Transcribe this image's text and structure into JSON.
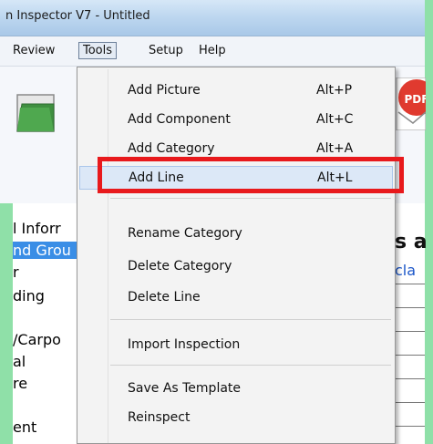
{
  "window": {
    "title": "n Inspector V7 - Untitled"
  },
  "menubar": {
    "items": [
      {
        "label": "Review",
        "active": false
      },
      {
        "label": "Tools",
        "active": true
      },
      {
        "label": "Setup",
        "active": false
      },
      {
        "label": "Help",
        "active": false
      }
    ]
  },
  "toolbar": {
    "pdf_label": "PDF"
  },
  "left_panel": {
    "items": [
      "l Inforr",
      "nd Grou",
      "r",
      "ding",
      "/Carpo",
      "al",
      "re",
      "ent"
    ]
  },
  "right_panel": {
    "heading": "s a",
    "link": "cla"
  },
  "tools_menu": {
    "items": [
      {
        "label": "Add Picture",
        "shortcut": "Alt+P"
      },
      {
        "label": "Add Component",
        "shortcut": "Alt+C"
      },
      {
        "label": "Add Category",
        "shortcut": "Alt+A"
      },
      {
        "label": "Add Line",
        "shortcut": "Alt+L"
      },
      {
        "label": "Rename Category",
        "shortcut": ""
      },
      {
        "label": "Delete Category",
        "shortcut": ""
      },
      {
        "label": "Delete Line",
        "shortcut": ""
      },
      {
        "label": "Import Inspection",
        "shortcut": ""
      },
      {
        "label": "Save As Template",
        "shortcut": ""
      },
      {
        "label": "Reinspect",
        "shortcut": ""
      }
    ],
    "hovered_index": 3
  },
  "colors": {
    "highlight_border": "#e8191c",
    "selection_bg": "#3a8ee6",
    "frame_green": "#8fe0a8"
  }
}
